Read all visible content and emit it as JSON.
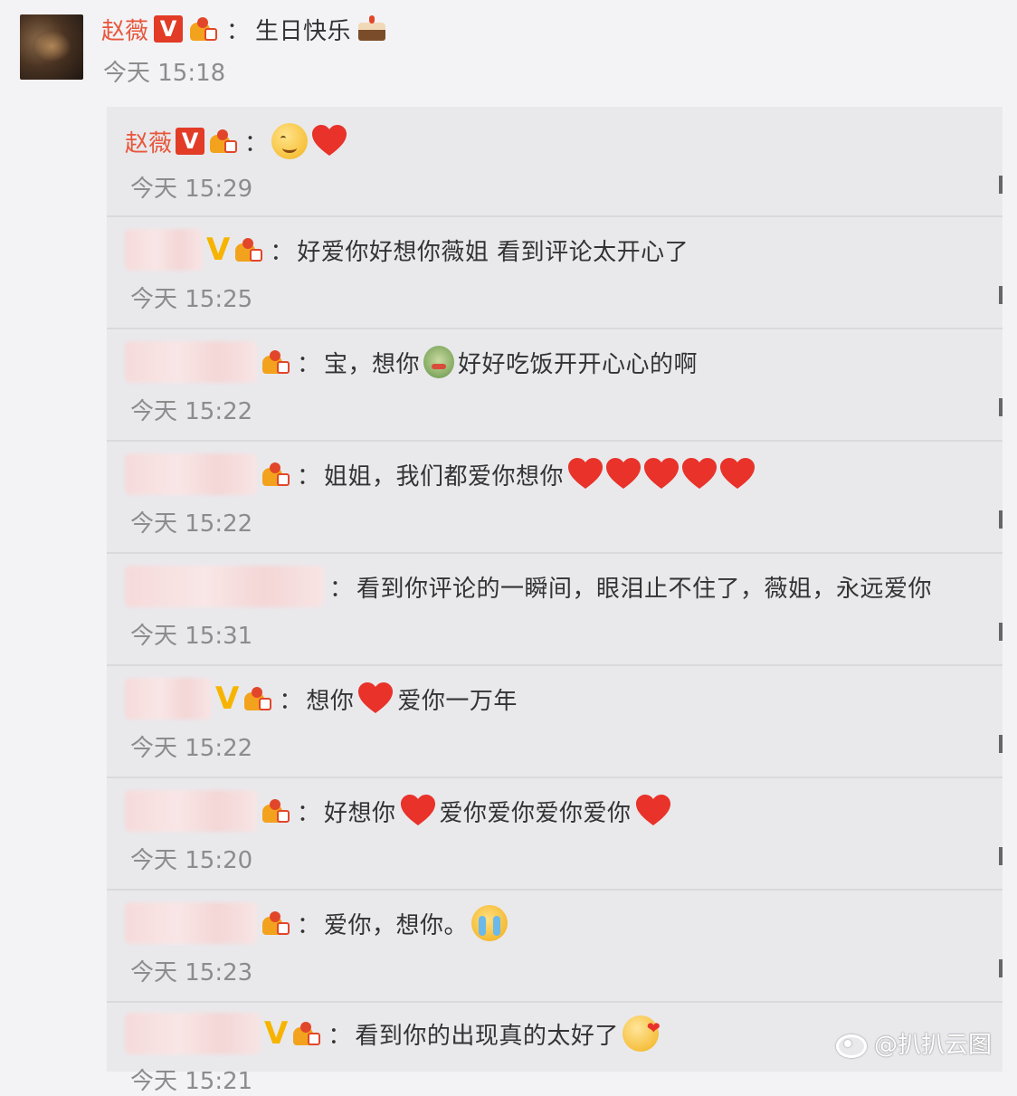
{
  "top_post": {
    "author": "赵薇",
    "verified_badge": "V",
    "message": "生日快乐",
    "message_emoji": "cake-icon",
    "time": "今天 15:18"
  },
  "replies": [
    {
      "author": "赵薇",
      "author_visible": true,
      "badge": "red-v",
      "message": "",
      "emoji": [
        "smile-icon",
        "heart-icon"
      ],
      "time": "今天 15:29"
    },
    {
      "author_visible": false,
      "badge": "gold-v",
      "message": "好爱你好想你薇姐 看到评论太开心了",
      "time": "今天 15:25"
    },
    {
      "author_visible": false,
      "badge": "",
      "message_a": "宝，想你",
      "message_b": "好好吃饭开开心心的啊",
      "time": "今天 15:22"
    },
    {
      "author_visible": false,
      "badge": "",
      "message": "姐姐，我们都爱你想你",
      "hearts": 5,
      "time": "今天 15:22"
    },
    {
      "author_visible": false,
      "badge": "",
      "message": "看到你评论的一瞬间，眼泪止不住了，薇姐，永远爱你",
      "time": "今天 15:31"
    },
    {
      "author_visible": false,
      "badge": "gold-v",
      "message_a": "想你",
      "message_b": "爱你一万年",
      "time": "今天 15:22"
    },
    {
      "author_visible": false,
      "badge": "",
      "message_a": "好想你",
      "message_b": "爱你爱你爱你爱你",
      "time": "今天 15:20"
    },
    {
      "author_visible": false,
      "badge": "",
      "message": "爱你，想你。",
      "time": "今天 15:23"
    },
    {
      "author_visible": false,
      "badge": "gold-v",
      "message": "看到你的出现真的太好了",
      "time": "今天 15:21"
    }
  ],
  "colon": "：",
  "watermark": "@扒扒云图",
  "colors": {
    "accent_red": "#e23b26",
    "name_red": "#e8563b",
    "gold_v": "#f6b400",
    "heart": "#e8322a"
  }
}
